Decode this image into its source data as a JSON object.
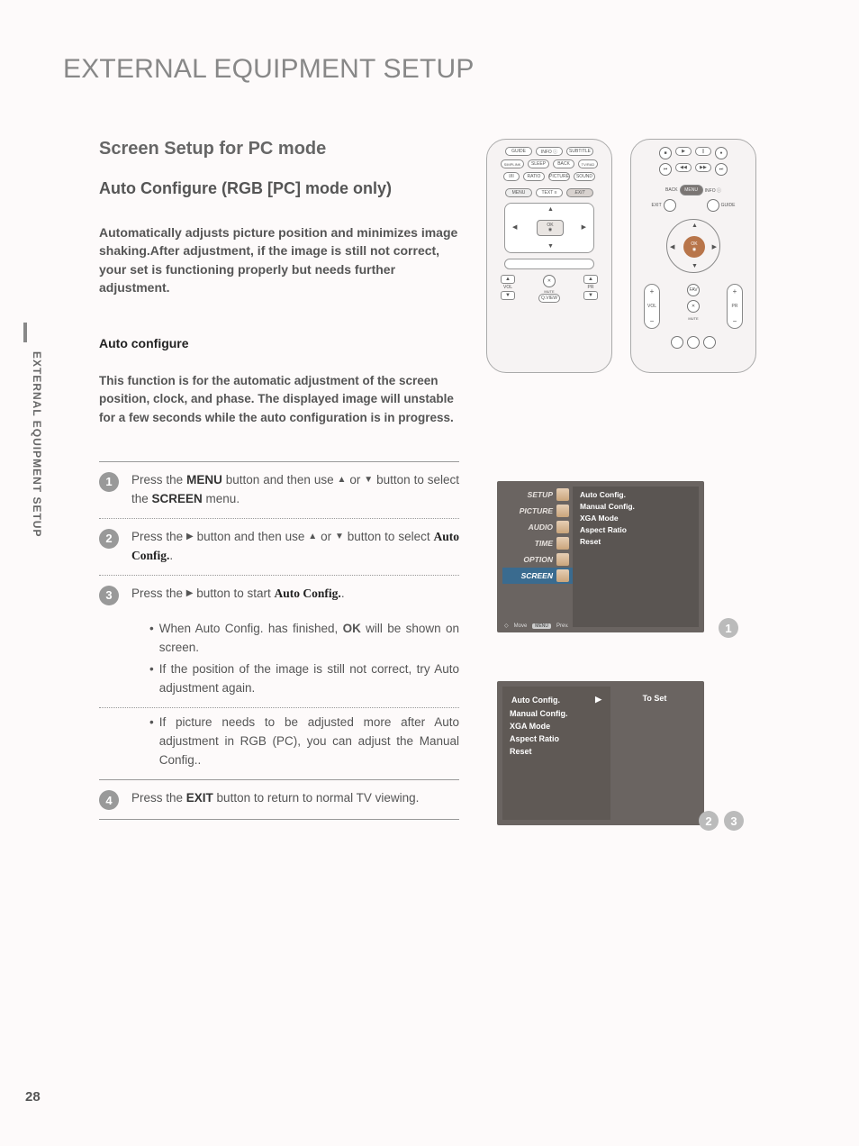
{
  "page_number": "28",
  "side_tab": "EXTERNAL EQUIPMENT SETUP",
  "main_title": "EXTERNAL EQUIPMENT SETUP",
  "section_title": "Screen Setup for PC mode",
  "sub_title": "Auto Configure (RGB [PC] mode only)",
  "intro": "Automatically adjusts picture position and minimizes image shaking.After adjustment, if the image is still not correct, your set is functioning properly but needs further adjustment.",
  "sub_heading": "Auto configure",
  "desc": "This function is for the automatic adjustment of the screen position, clock, and phase. The displayed image will unstable for a few seconds while the auto configuration is in progress.",
  "steps": {
    "s1_a": "Press the ",
    "s1_menu": "MENU",
    "s1_b": " button and then use ",
    "s1_c": " or ",
    "s1_d": " button to select the ",
    "s1_screen": "SCREEN",
    "s1_e": " menu.",
    "s2_a": "Press the ",
    "s2_b": " button and then use ",
    "s2_c": " or ",
    "s2_d": " button to select ",
    "s2_ac": "Auto Config.",
    "s2_e": ".",
    "s3_a": "Press the ",
    "s3_b": " button to start ",
    "s3_ac": "Auto Config.",
    "s3_c": ".",
    "b1_a": "When ",
    "b1_ac": "Auto Config.",
    "b1_b": " has finished, ",
    "b1_ok": "OK",
    "b1_c": " will be shown on screen.",
    "b2": "If the position of the image is still not correct, try Auto adjustment again.",
    "b3_a": "If picture needs to be adjusted more after Auto adjustment in RGB (PC), you can adjust the ",
    "b3_mc": "Manual Config.",
    "b3_b": ".",
    "s4_a": "Press the ",
    "s4_exit": "EXIT",
    "s4_b": " button to return to normal TV viewing."
  },
  "remote1": {
    "r1": [
      "GUIDE",
      "INFO ⓘ",
      "SUBTITLE"
    ],
    "r2": [
      "SLEEP",
      "BACK"
    ],
    "r3": [
      "RATIO",
      "PICTURE",
      "SOUND"
    ],
    "r4": [
      "MENU",
      "TEXT ≡",
      "EXIT"
    ],
    "ok": "OK",
    "vol": "VOL",
    "pr": "PR",
    "mute": "MUTE",
    "qview": "Q.VIEW",
    "simplink": "SIMPLINK",
    "tvradio": "TV/RAD",
    "iii": "I/II"
  },
  "remote2": {
    "back": "BACK",
    "menu": "MENU",
    "info": "INFO ⓘ",
    "exit": "EXIT",
    "guide": "GUIDE",
    "ok": "OK",
    "vol": "VOL",
    "pr": "PR",
    "fav": "FAV",
    "mute": "MUTE"
  },
  "osd1": {
    "left": [
      "SETUP",
      "PICTURE",
      "AUDIO",
      "TIME",
      "OPTION",
      "SCREEN"
    ],
    "right": [
      "Auto Config.",
      "Manual Config.",
      "XGA Mode",
      "Aspect Ratio",
      "Reset"
    ],
    "foot_move": "Move",
    "foot_menu": "MENU",
    "foot_prev": "Prev.",
    "badge": "1"
  },
  "osd2": {
    "left": [
      "Auto Config.",
      "Manual Config.",
      "XGA Mode",
      "Aspect Ratio",
      "Reset"
    ],
    "right": "To Set",
    "badges": [
      "2",
      "3"
    ]
  }
}
